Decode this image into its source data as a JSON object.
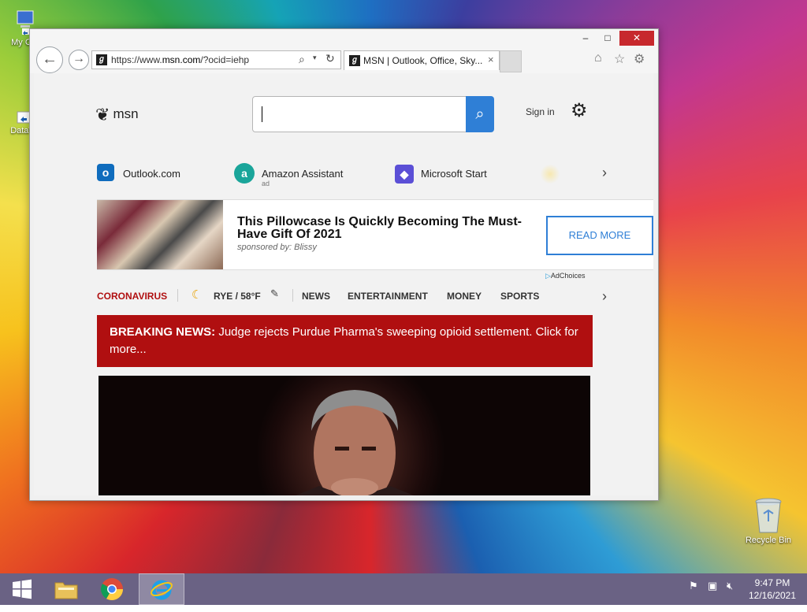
{
  "desktop": {
    "icons": [
      {
        "label": "My Co"
      },
      {
        "label": "DataW"
      },
      {
        "label": "Recycle Bin"
      }
    ]
  },
  "window": {
    "controls": {
      "minimize": "–",
      "maximize": "□",
      "close": "✕"
    },
    "address": {
      "prefix": "https://www.",
      "domain": "msn.com",
      "suffix": "/?ocid=iehp"
    },
    "tab": {
      "title": "MSN | Outlook, Office, Sky...",
      "close": "×"
    }
  },
  "msn": {
    "logo": "msn",
    "search": {
      "value": "",
      "placeholder": ""
    },
    "signin": "Sign in",
    "quicklinks": [
      {
        "label": "Outlook.com"
      },
      {
        "label": "Amazon Assistant",
        "sub": "ad"
      },
      {
        "label": "Microsoft Start"
      }
    ],
    "ad": {
      "title": "This Pillowcase Is Quickly Becoming The Must-Have Gift Of 2021",
      "sponsor": "sponsored by: Blissy",
      "button": "READ MORE",
      "adchoices": "AdChoices"
    },
    "nav": {
      "coronavirus": "CORONAVIRUS",
      "weather": "RYE / 58°F",
      "items": [
        "NEWS",
        "ENTERTAINMENT",
        "MONEY",
        "SPORTS"
      ]
    },
    "breaking": {
      "label": "BREAKING NEWS:",
      "text": " Judge rejects Purdue Pharma's sweeping opioid settlement. Click for more..."
    }
  },
  "taskbar": {
    "clock": {
      "time": "9:47 PM",
      "date": "12/16/2021"
    }
  },
  "colors": {
    "accent": "#2f7fd6",
    "breaking": "#b00f10",
    "coronavirus": "#b00f10"
  }
}
